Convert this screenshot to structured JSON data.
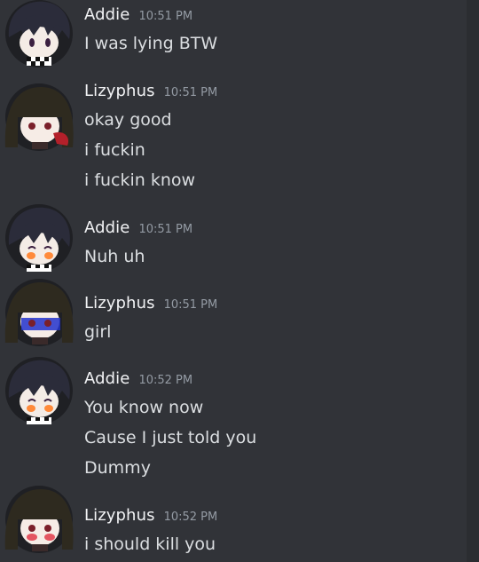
{
  "messages": [
    {
      "author": "Addie",
      "time": "10:51 PM",
      "lines": [
        "I was lying BTW"
      ]
    },
    {
      "author": "Lizyphus",
      "time": "10:51 PM",
      "lines": [
        "okay good",
        "i fuckin",
        "i fuckin know"
      ]
    },
    {
      "author": "Addie",
      "time": "10:51 PM",
      "lines": [
        "Nuh uh"
      ]
    },
    {
      "author": "Lizyphus",
      "time": "10:51 PM",
      "lines": [
        "girl"
      ]
    },
    {
      "author": "Addie",
      "time": "10:52 PM",
      "lines": [
        "You know now",
        "Cause I just told you",
        "Dummy"
      ]
    },
    {
      "author": "Lizyphus",
      "time": "10:52 PM",
      "lines": [
        "i should kill you"
      ]
    }
  ],
  "colors": {
    "background": "#313338",
    "author": "#f2f3f5",
    "timestamp": "#949ba4",
    "text": "#dbdee1"
  }
}
